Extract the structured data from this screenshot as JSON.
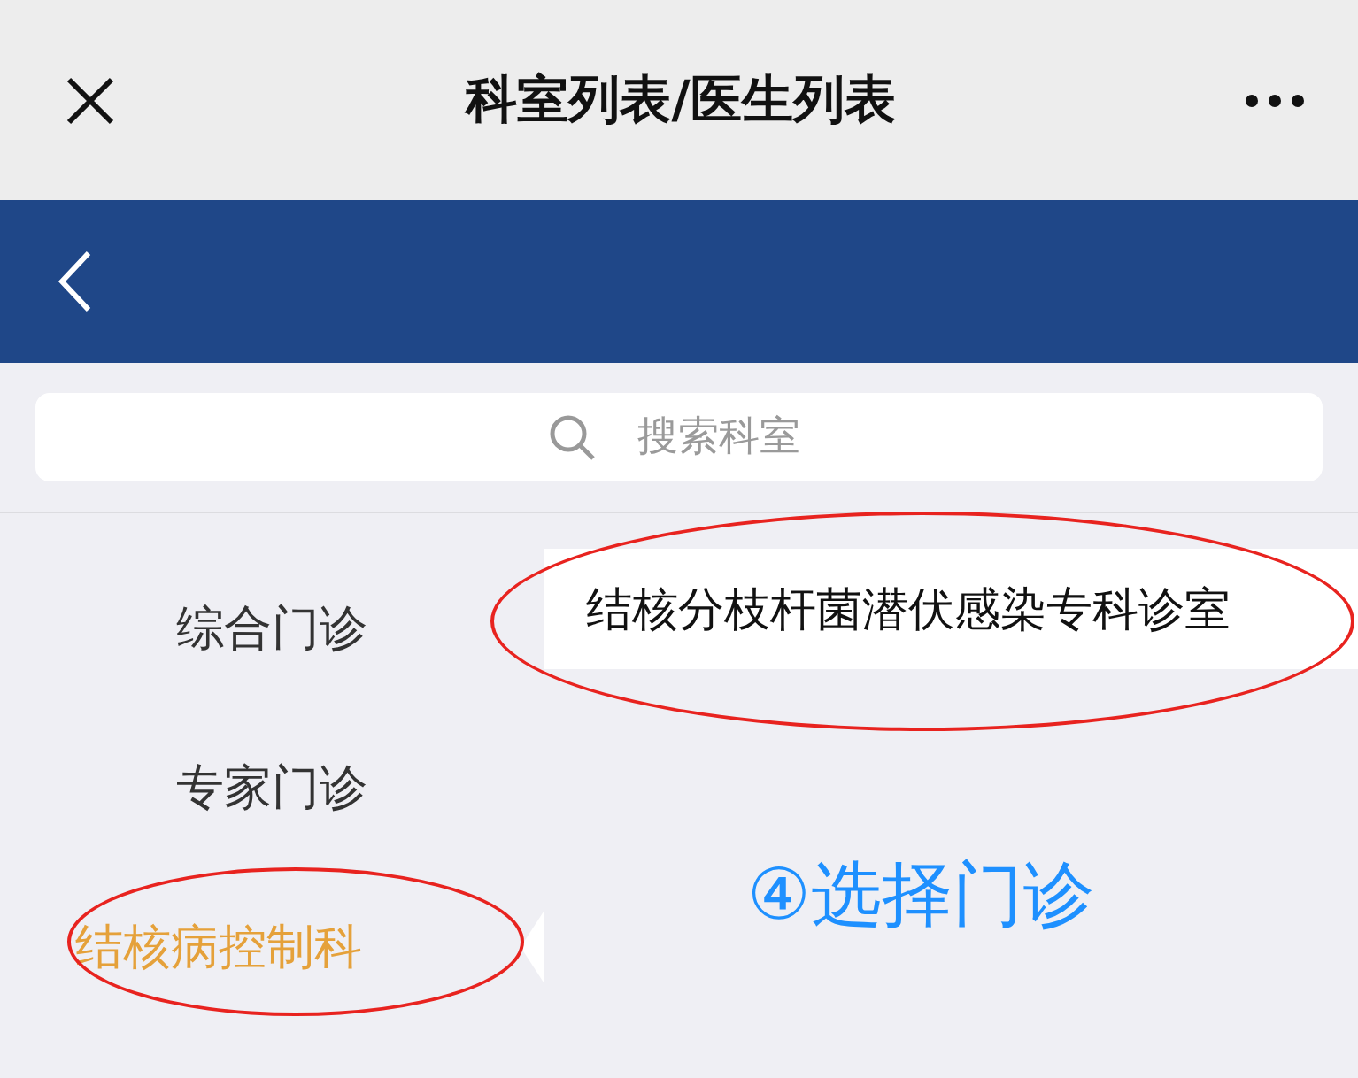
{
  "window": {
    "title": "科室列表/医生列表"
  },
  "search": {
    "placeholder": "搜索科室"
  },
  "departments": [
    {
      "label": "综合门诊",
      "selected": false,
      "circled": false
    },
    {
      "label": "专家门诊",
      "selected": false,
      "circled": false
    },
    {
      "label": "结核病控制科",
      "selected": true,
      "circled": true
    }
  ],
  "clinics": [
    {
      "label": "结核分枝杆菌潜伏感染专科诊室",
      "circled": true
    }
  ],
  "annotation": {
    "text": "④选择门诊"
  }
}
